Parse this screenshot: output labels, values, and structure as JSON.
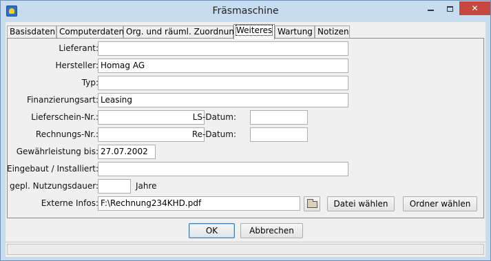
{
  "window": {
    "title": "Fräsmaschine",
    "controls": {
      "minimize": "minimize-icon",
      "maximize": "maximize-icon",
      "close": "✕"
    }
  },
  "tabs": [
    {
      "label": "Basisdaten",
      "active": false
    },
    {
      "label": "Computerdaten",
      "active": false
    },
    {
      "label": "Org. und räuml. Zuordnung",
      "active": false
    },
    {
      "label": "Weiteres",
      "active": true
    },
    {
      "label": "Wartung",
      "active": false
    },
    {
      "label": "Notizen",
      "active": false
    }
  ],
  "form": {
    "lieferant": {
      "label": "Lieferant:",
      "value": ""
    },
    "hersteller": {
      "label": "Hersteller:",
      "value": "Homag AG"
    },
    "typ": {
      "label": "Typ:",
      "value": ""
    },
    "finanzierungsart": {
      "label": "Finanzierungsart:",
      "value": "Leasing"
    },
    "lieferschein_nr": {
      "label": "Lieferschein-Nr.:",
      "value": ""
    },
    "ls_datum": {
      "label": "LS-Datum:",
      "value": ""
    },
    "rechnungs_nr": {
      "label": "Rechnungs-Nr.:",
      "value": ""
    },
    "re_datum": {
      "label": "Re-Datum:",
      "value": ""
    },
    "gewaehrleistung_bis": {
      "label": "Gewährleistung bis:",
      "value": "27.07.2002"
    },
    "eingebaut": {
      "label": "Eingebaut / Installiert:",
      "value": ""
    },
    "nutzungsdauer": {
      "label": "gepl. Nutzungsdauer:",
      "value": "",
      "unit": "Jahre"
    },
    "externe_infos": {
      "label": "Externe Infos:",
      "value": "F:\\Rechnung234KHD.pdf"
    }
  },
  "buttons": {
    "datei_waehlen": "Datei wählen",
    "ordner_waehlen": "Ordner wählen",
    "ok": "OK",
    "abbrechen": "Abbrechen"
  },
  "colors": {
    "titlebar": "#c8dcef",
    "close_button": "#c7463d",
    "default_button_border": "#3c7fb1"
  }
}
